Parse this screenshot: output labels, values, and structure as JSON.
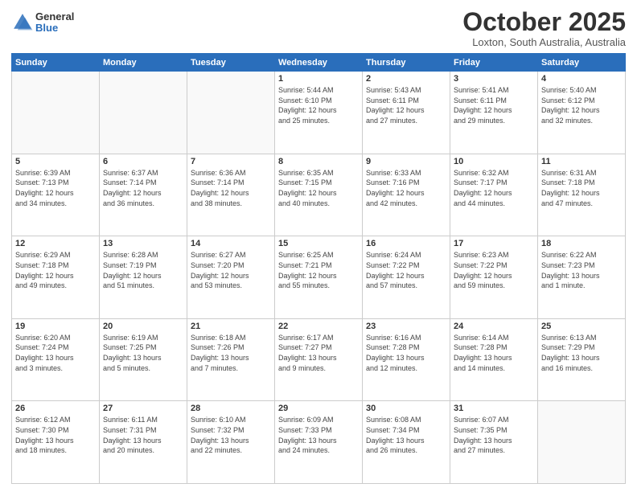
{
  "header": {
    "logo_general": "General",
    "logo_blue": "Blue",
    "month_title": "October 2025",
    "location": "Loxton, South Australia, Australia"
  },
  "weekdays": [
    "Sunday",
    "Monday",
    "Tuesday",
    "Wednesday",
    "Thursday",
    "Friday",
    "Saturday"
  ],
  "weeks": [
    [
      {
        "day": "",
        "info": ""
      },
      {
        "day": "",
        "info": ""
      },
      {
        "day": "",
        "info": ""
      },
      {
        "day": "1",
        "info": "Sunrise: 5:44 AM\nSunset: 6:10 PM\nDaylight: 12 hours\nand 25 minutes."
      },
      {
        "day": "2",
        "info": "Sunrise: 5:43 AM\nSunset: 6:11 PM\nDaylight: 12 hours\nand 27 minutes."
      },
      {
        "day": "3",
        "info": "Sunrise: 5:41 AM\nSunset: 6:11 PM\nDaylight: 12 hours\nand 29 minutes."
      },
      {
        "day": "4",
        "info": "Sunrise: 5:40 AM\nSunset: 6:12 PM\nDaylight: 12 hours\nand 32 minutes."
      }
    ],
    [
      {
        "day": "5",
        "info": "Sunrise: 6:39 AM\nSunset: 7:13 PM\nDaylight: 12 hours\nand 34 minutes."
      },
      {
        "day": "6",
        "info": "Sunrise: 6:37 AM\nSunset: 7:14 PM\nDaylight: 12 hours\nand 36 minutes."
      },
      {
        "day": "7",
        "info": "Sunrise: 6:36 AM\nSunset: 7:14 PM\nDaylight: 12 hours\nand 38 minutes."
      },
      {
        "day": "8",
        "info": "Sunrise: 6:35 AM\nSunset: 7:15 PM\nDaylight: 12 hours\nand 40 minutes."
      },
      {
        "day": "9",
        "info": "Sunrise: 6:33 AM\nSunset: 7:16 PM\nDaylight: 12 hours\nand 42 minutes."
      },
      {
        "day": "10",
        "info": "Sunrise: 6:32 AM\nSunset: 7:17 PM\nDaylight: 12 hours\nand 44 minutes."
      },
      {
        "day": "11",
        "info": "Sunrise: 6:31 AM\nSunset: 7:18 PM\nDaylight: 12 hours\nand 47 minutes."
      }
    ],
    [
      {
        "day": "12",
        "info": "Sunrise: 6:29 AM\nSunset: 7:18 PM\nDaylight: 12 hours\nand 49 minutes."
      },
      {
        "day": "13",
        "info": "Sunrise: 6:28 AM\nSunset: 7:19 PM\nDaylight: 12 hours\nand 51 minutes."
      },
      {
        "day": "14",
        "info": "Sunrise: 6:27 AM\nSunset: 7:20 PM\nDaylight: 12 hours\nand 53 minutes."
      },
      {
        "day": "15",
        "info": "Sunrise: 6:25 AM\nSunset: 7:21 PM\nDaylight: 12 hours\nand 55 minutes."
      },
      {
        "day": "16",
        "info": "Sunrise: 6:24 AM\nSunset: 7:22 PM\nDaylight: 12 hours\nand 57 minutes."
      },
      {
        "day": "17",
        "info": "Sunrise: 6:23 AM\nSunset: 7:22 PM\nDaylight: 12 hours\nand 59 minutes."
      },
      {
        "day": "18",
        "info": "Sunrise: 6:22 AM\nSunset: 7:23 PM\nDaylight: 13 hours\nand 1 minute."
      }
    ],
    [
      {
        "day": "19",
        "info": "Sunrise: 6:20 AM\nSunset: 7:24 PM\nDaylight: 13 hours\nand 3 minutes."
      },
      {
        "day": "20",
        "info": "Sunrise: 6:19 AM\nSunset: 7:25 PM\nDaylight: 13 hours\nand 5 minutes."
      },
      {
        "day": "21",
        "info": "Sunrise: 6:18 AM\nSunset: 7:26 PM\nDaylight: 13 hours\nand 7 minutes."
      },
      {
        "day": "22",
        "info": "Sunrise: 6:17 AM\nSunset: 7:27 PM\nDaylight: 13 hours\nand 9 minutes."
      },
      {
        "day": "23",
        "info": "Sunrise: 6:16 AM\nSunset: 7:28 PM\nDaylight: 13 hours\nand 12 minutes."
      },
      {
        "day": "24",
        "info": "Sunrise: 6:14 AM\nSunset: 7:28 PM\nDaylight: 13 hours\nand 14 minutes."
      },
      {
        "day": "25",
        "info": "Sunrise: 6:13 AM\nSunset: 7:29 PM\nDaylight: 13 hours\nand 16 minutes."
      }
    ],
    [
      {
        "day": "26",
        "info": "Sunrise: 6:12 AM\nSunset: 7:30 PM\nDaylight: 13 hours\nand 18 minutes."
      },
      {
        "day": "27",
        "info": "Sunrise: 6:11 AM\nSunset: 7:31 PM\nDaylight: 13 hours\nand 20 minutes."
      },
      {
        "day": "28",
        "info": "Sunrise: 6:10 AM\nSunset: 7:32 PM\nDaylight: 13 hours\nand 22 minutes."
      },
      {
        "day": "29",
        "info": "Sunrise: 6:09 AM\nSunset: 7:33 PM\nDaylight: 13 hours\nand 24 minutes."
      },
      {
        "day": "30",
        "info": "Sunrise: 6:08 AM\nSunset: 7:34 PM\nDaylight: 13 hours\nand 26 minutes."
      },
      {
        "day": "31",
        "info": "Sunrise: 6:07 AM\nSunset: 7:35 PM\nDaylight: 13 hours\nand 27 minutes."
      },
      {
        "day": "",
        "info": ""
      }
    ]
  ]
}
